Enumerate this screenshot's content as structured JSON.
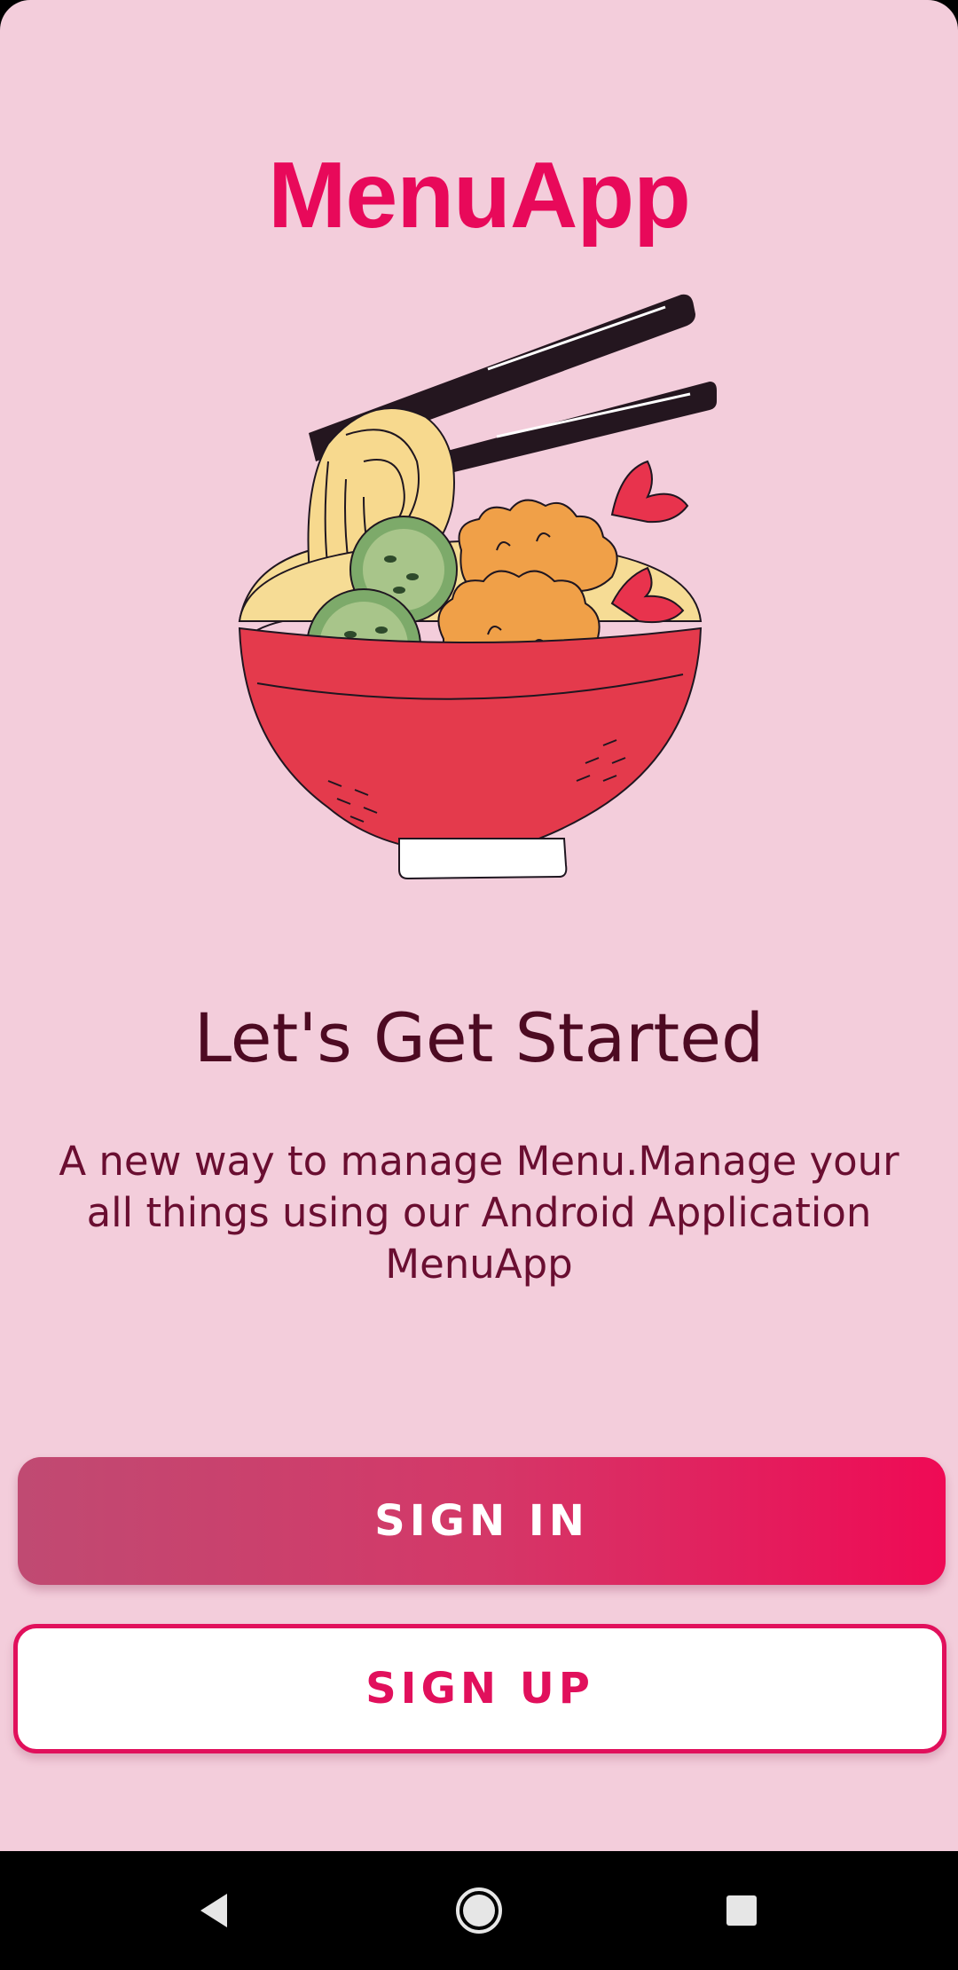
{
  "app": {
    "title": "MenuApp"
  },
  "hero": {
    "image": "noodle-bowl-illustration"
  },
  "intro": {
    "headline": "Let's Get Started",
    "description": "A new way to manage Menu.Manage your all things using our Android Application MenuApp"
  },
  "actions": {
    "sign_in_label": "SIGN IN",
    "sign_up_label": "SIGN UP"
  },
  "navigation": {
    "back_icon": "back-triangle-icon",
    "home_icon": "home-circle-icon",
    "recents_icon": "recents-square-icon"
  },
  "colors": {
    "background": "#f3cddb",
    "accent": "#e8095a",
    "headline": "#4d0a22",
    "gradient_start": "#c04a72",
    "gradient_end": "#ef0a55"
  }
}
